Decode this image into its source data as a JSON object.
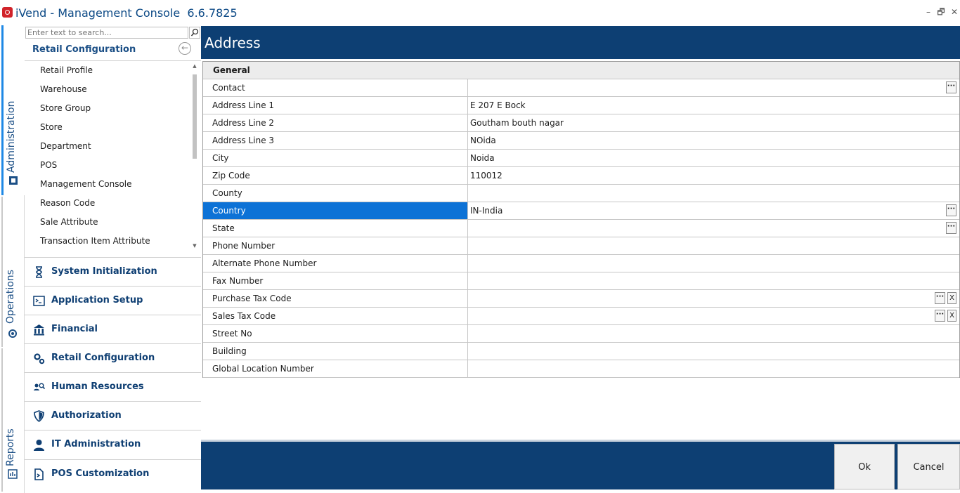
{
  "window": {
    "title": "iVend - Management Console",
    "version": "6.6.7825",
    "controls": {
      "minimize": "–",
      "restore": "🗗",
      "close": "✕"
    }
  },
  "side_tabs": [
    {
      "label": "Administration",
      "icon": "admin-icon",
      "active": true
    },
    {
      "label": "Operations",
      "icon": "gear-icon",
      "active": false
    },
    {
      "label": "Reports",
      "icon": "reports-icon",
      "active": false
    }
  ],
  "left_panel": {
    "search_placeholder": "Enter text to search...",
    "section_title": "Retail Configuration",
    "sub_items": [
      "Retail Profile",
      "Warehouse",
      "Store Group",
      "Store",
      "Department",
      "POS",
      "Management Console",
      "Reason Code",
      "Sale Attribute",
      "Transaction Item Attribute"
    ],
    "groups": [
      {
        "label": "System Initialization",
        "icon": "hourglass-icon"
      },
      {
        "label": "Application Setup",
        "icon": "terminal-icon"
      },
      {
        "label": "Financial",
        "icon": "bank-icon"
      },
      {
        "label": "Retail Configuration",
        "icon": "gears-icon"
      },
      {
        "label": "Human Resources",
        "icon": "people-search-icon"
      },
      {
        "label": "Authorization",
        "icon": "shield-icon"
      },
      {
        "label": "IT Administration",
        "icon": "user-admin-icon"
      },
      {
        "label": "POS Customization",
        "icon": "pos-custom-icon"
      }
    ]
  },
  "main": {
    "title": "Address",
    "category": "General",
    "properties": [
      {
        "name": "Contact",
        "value": "",
        "ellipsis": true,
        "clear": false
      },
      {
        "name": "Address Line 1",
        "value": "E 207  E Bock"
      },
      {
        "name": "Address Line 2",
        "value": "Goutham bouth nagar"
      },
      {
        "name": "Address Line 3",
        "value": "NOida"
      },
      {
        "name": "City",
        "value": "Noida"
      },
      {
        "name": "Zip Code",
        "value": "110012"
      },
      {
        "name": "County",
        "value": ""
      },
      {
        "name": "Country",
        "value": "IN-India",
        "ellipsis": true,
        "selected": true
      },
      {
        "name": "State",
        "value": "",
        "ellipsis": true
      },
      {
        "name": "Phone Number",
        "value": ""
      },
      {
        "name": "Alternate Phone Number",
        "value": ""
      },
      {
        "name": "Fax Number",
        "value": ""
      },
      {
        "name": "Purchase Tax Code",
        "value": "",
        "ellipsis": true,
        "clear": true
      },
      {
        "name": "Sales Tax Code",
        "value": "",
        "ellipsis": true,
        "clear": true
      },
      {
        "name": "Street No",
        "value": ""
      },
      {
        "name": "Building",
        "value": ""
      },
      {
        "name": "Global Location Number",
        "value": ""
      }
    ],
    "ellipsis_label": "···",
    "clear_label": "X"
  },
  "footer": {
    "ok_label": "Ok",
    "cancel_label": "Cancel"
  },
  "colors": {
    "header": "#0d3f73",
    "selected": "#0d72d6",
    "nav_text": "#0f3f73"
  }
}
